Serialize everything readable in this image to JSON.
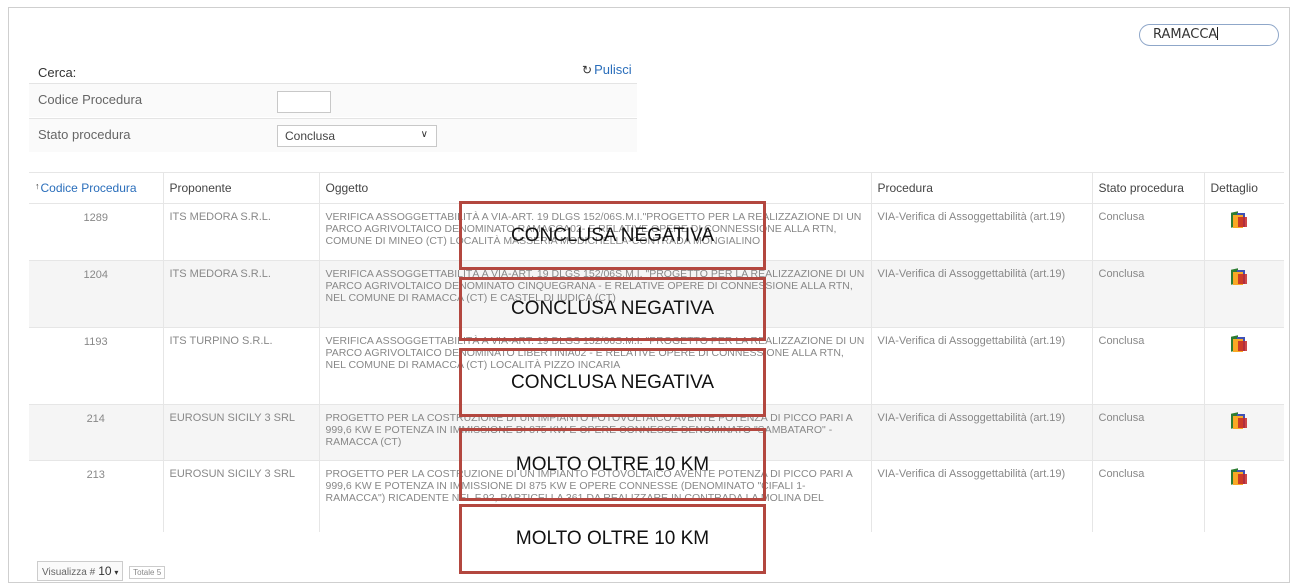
{
  "search": {
    "value": "RAMACCA"
  },
  "filters": {
    "title": "Cerca:",
    "clear_label": "Pulisci",
    "codice_label": "Codice Procedura",
    "codice_value": "",
    "stato_label": "Stato procedura",
    "stato_value": "Conclusa"
  },
  "table": {
    "headers": [
      "Codice Procedura",
      "Proponente",
      "Oggetto",
      "Procedura",
      "Stato procedura",
      "Dettaglio"
    ],
    "rows": [
      {
        "codice": "1289",
        "proponente": "ITS MEDORA S.R.L.",
        "oggetto": "VERIFICA ASSOGGETTABILITÀ A VIA-ART. 19 DLGS 152/06S.M.I.\"PROGETTO PER LA REALIZZAZIONE DI UN PARCO AGRIVOLTAICO DENOMINATO RAMACCA02- E RELATIVE OPERE DI CONNESSIONE ALLA RTN, COMUNE DI MINEO (CT) LOCALITÀ MASSERIA MODICHELLA-CONTRADA MONGIALINO",
        "procedura": "VIA-Verifica di Assoggettabilità (art.19)",
        "stato": "Conclusa"
      },
      {
        "codice": "1204",
        "proponente": "ITS MEDORA S.R.L.",
        "oggetto": "VERIFICA ASSOGGETTABILITÀ A VIA-ART. 19 DLGS 152/06S.M.I. \"PROGETTO PER LA REALIZZAZIONE DI UN PARCO AGRIVOLTAICO DENOMINATO CINQUEGRANA - E RELATIVE OPERE DI CONNESSIONE ALLA RTN, NEL COMUNE DI RAMACCA (CT) E CASTEL DI IUDICA (CT)",
        "procedura": "VIA-Verifica di Assoggettabilità (art.19)",
        "stato": "Conclusa"
      },
      {
        "codice": "1193",
        "proponente": "ITS TURPINO S.R.L.",
        "oggetto": "VERIFICA ASSOGGETTABILITÀ A VIA-ART. 19 DLGS 152/06S.M.I. \"PROGETTO PER LA REALIZZAZIONE DI UN PARCO AGRIVOLTAICO DENOMINATO LIBERTINIA02 - E RELATIVE OPERE DI CONNESSIONE ALLA RTN, NEL COMUNE DI RAMACCA (CT) LOCALITÀ PIZZO INCARIA",
        "procedura": "VIA-Verifica di Assoggettabilità (art.19)",
        "stato": "Conclusa"
      },
      {
        "codice": "214",
        "proponente": "EUROSUN SICILY 3 SRL",
        "oggetto": "PROGETTO PER LA COSTRUZIONE DI UN IMPIANTO FOTOVOLTAICO AVENTE POTENZA DI PICCO PARI A 999,6 KW E POTENZA IN IMMISSIONE DI 875 KW E OPERE CONNESSE DENOMINATO \"SAMBATARO\" - RAMACCA (CT)",
        "procedura": "VIA-Verifica di Assoggettabilità (art.19)",
        "stato": "Conclusa"
      },
      {
        "codice": "213",
        "proponente": "EUROSUN SICILY 3 SRL",
        "oggetto": "PROGETTO PER LA COSTRUZIONE DI UN IMPIANTO FOTOVOLTAICO AVENTE POTENZA DI PICCO PARI A 999,6 KW E POTENZA IN IMMISSIONE DI 875 KW E OPERE CONNESSE (DENOMINATO \"CIFALI 1-RAMACCA\") RICADENTE NEL F.92, PARTICELLA 361 DA REALIZZARE IN CONTRADA LA MOLINA DEL",
        "procedura": "VIA-Verifica di Assoggettabilità (art.19)",
        "stato": "Conclusa"
      }
    ]
  },
  "annotations": [
    "CONCLUSA NEGATIVA",
    "CONCLUSA NEGATIVA",
    "CONCLUSA NEGATIVA",
    "MOLTO OLTRE 10 KM",
    "MOLTO OLTRE 10 KM"
  ],
  "footer": {
    "show_label": "Visualizza #",
    "page_size": "10",
    "total": "Totale 5"
  },
  "colors": {
    "link": "#2a6ebb",
    "annotation_border": "#b3473f"
  }
}
